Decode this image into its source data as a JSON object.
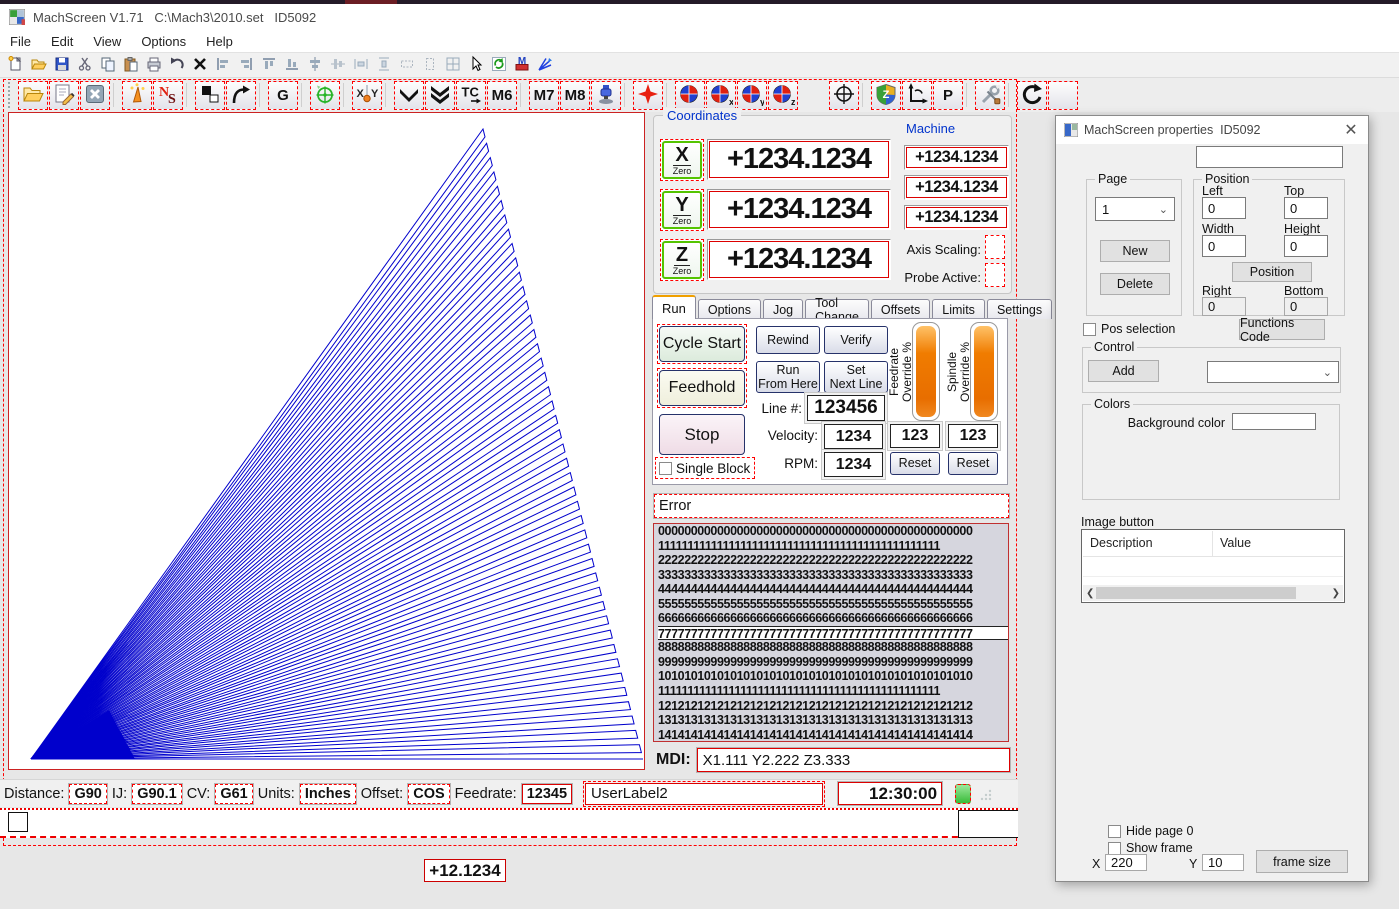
{
  "window": {
    "title": "MachScreen V1.71   C:\\Mach3\\2010.set   ID5092"
  },
  "menu": {
    "items": [
      "File",
      "Edit",
      "View",
      "Options",
      "Help"
    ]
  },
  "toolbar1": {
    "icons": [
      "new",
      "open",
      "save",
      "cut",
      "copy",
      "paste",
      "print",
      "undo",
      "delete-x",
      "align-left",
      "align-right",
      "align-top",
      "align-bottom",
      "center-v",
      "center-h",
      "space-h",
      "space-v",
      "size-a",
      "size-b",
      "grid",
      "pointer",
      "refresh-green",
      "export-m",
      "chart-fan"
    ]
  },
  "toolbar2": {
    "items": [
      {
        "icon": "folder-open"
      },
      {
        "icon": "edit-page"
      },
      {
        "icon": "close-x"
      },
      {
        "sep": true
      },
      {
        "icon": "wand"
      },
      {
        "icon": "ns-letters"
      },
      {
        "sep": true
      },
      {
        "icon": "squares"
      },
      {
        "icon": "curved-arrow"
      },
      {
        "sep": true
      },
      {
        "icon": "g-letter",
        "text": "G"
      },
      {
        "sep": true
      },
      {
        "icon": "green-target"
      },
      {
        "sep": true
      },
      {
        "icon": "xy-plumb"
      },
      {
        "sep": true
      },
      {
        "icon": "chevron-single"
      },
      {
        "icon": "chevron-double"
      },
      {
        "icon": "tc"
      },
      {
        "icon": "m-code",
        "text": "M6"
      },
      {
        "sep": true
      },
      {
        "icon": "m-code",
        "text": "M7"
      },
      {
        "icon": "m-code",
        "text": "M8"
      },
      {
        "icon": "spindle"
      },
      {
        "sep": true
      },
      {
        "icon": "red-cross"
      },
      {
        "sep": true
      },
      {
        "icon": "quad-circle"
      },
      {
        "icon": "quad-circle",
        "sub": "x"
      },
      {
        "icon": "quad-circle",
        "sub": "y"
      },
      {
        "icon": "quad-circle",
        "sub": "z"
      },
      {
        "gap": 30
      },
      {
        "icon": "crosshair"
      },
      {
        "sep": true
      },
      {
        "icon": "shield-z"
      },
      {
        "icon": "axis-return"
      },
      {
        "icon": "p-letter",
        "text": "P"
      },
      {
        "sep": true
      },
      {
        "icon": "tools"
      },
      {
        "sep": true
      },
      {
        "icon": "refresh-c"
      },
      {
        "icon": "empty"
      }
    ]
  },
  "coordinates": {
    "group_label": "Coordinates",
    "machine_label": "Machine",
    "zero_word": "Zero",
    "axes": [
      {
        "letter": "X",
        "dro": "+1234.1234",
        "machine": "+1234.1234"
      },
      {
        "letter": "Y",
        "dro": "+1234.1234",
        "machine": "+1234.1234"
      },
      {
        "letter": "Z",
        "dro": "+1234.1234",
        "machine": "+1234.1234"
      }
    ],
    "axis_scaling_label": "Axis Scaling:",
    "probe_active_label": "Probe Active:"
  },
  "tabs": {
    "labels": [
      "Run",
      "Options",
      "Jog",
      "Tool Change",
      "Offsets",
      "Limits",
      "Settings"
    ],
    "active": "Run"
  },
  "run_tab": {
    "cycle_start": "Cycle Start",
    "feedhold": "Feedhold",
    "stop": "Stop",
    "single_block": "Single Block",
    "rewind": "Rewind",
    "verify": "Verify",
    "run_from_here": "Run\nFrom Here",
    "set_next_line": "Set\nNext Line",
    "line_label": "Line #:",
    "line_value": "123456",
    "velocity_label": "Velocity:",
    "velocity_value": "1234",
    "rpm_label": "RPM:",
    "rpm_value": "1234",
    "feedrate_override_label": "Feedrate\nOverride %",
    "spindle_override_label": "Spindle\nOverride %",
    "feedrate_override_value": "123",
    "spindle_override_value": "123",
    "reset_label": "Reset"
  },
  "error_text": "Error",
  "gcode": {
    "highlight_index": 7,
    "rows": [
      "000000000000000000000000000000000000000000000000",
      "111111111111111111111111111111111111111111111111",
      "222222222222222222222222222222222222222222222222",
      "333333333333333333333333333333333333333333333333",
      "444444444444444444444444444444444444444444444444",
      "555555555555555555555555555555555555555555555555",
      "666666666666666666666666666666666666666666666666",
      "777777777777777777777777777777777777777777777777",
      "888888888888888888888888888888888888888888888888",
      "999999999999999999999999999999999999999999999999",
      "101010101010101010101010101010101010101010101010",
      "111111111111111111111111111111111111111111111111",
      "121212121212121212121212121212121212121212121212",
      "131313131313131313131313131313131313131313131313",
      "141414141414141414141414141414141414141414141414"
    ]
  },
  "mdi": {
    "label": "MDI:",
    "value": "X1.111 Y2.222 Z3.333"
  },
  "statusbar": {
    "items": [
      {
        "label": "Distance:",
        "value": "G90",
        "style": "dash"
      },
      {
        "label": "IJ:",
        "value": "G90.1",
        "style": "dash"
      },
      {
        "label": "CV:",
        "value": "G61",
        "style": "dash"
      },
      {
        "label": "Units:",
        "value": "Inches",
        "style": "dash"
      },
      {
        "label": "Offset:",
        "value": "COS",
        "style": "dash"
      },
      {
        "label": "Feedrate:",
        "value": "12345",
        "style": "solid"
      }
    ],
    "user_label": "UserLabel2",
    "time": "12:30:00"
  },
  "bottom": {
    "dro_value": "+12.1234"
  },
  "dialog": {
    "title": "MachScreen properties  ID5092",
    "close": "✕",
    "page": {
      "label": "Page",
      "selected": "1",
      "new_btn": "New",
      "delete_btn": "Delete"
    },
    "position": {
      "label": "Position",
      "left_label": "Left",
      "left": "0",
      "top_label": "Top",
      "top": "0",
      "width_label": "Width",
      "width": "0",
      "height_label": "Height",
      "height": "0",
      "button": "Position",
      "right_label": "Right",
      "right": "0",
      "bottom_label": "Bottom",
      "bottom": "0"
    },
    "pos_selection": "Pos selection",
    "functions_code": "Functions Code",
    "control": {
      "label": "Control",
      "add_btn": "Add"
    },
    "colors": {
      "label": "Colors",
      "background_label": "Background color"
    },
    "image_button": {
      "label": "Image button",
      "col1": "Description",
      "col2": "Value"
    },
    "hide_page": "Hide page 0",
    "show_frame": "Show frame",
    "x_label": "X",
    "x_value": "220",
    "y_label": "Y",
    "y_value": "10",
    "frame_size": "frame size"
  },
  "plot": {
    "stroke": "#0000cc",
    "petals": 44,
    "cap_fraction": 0.55,
    "origin": [
      22,
      646
    ],
    "apex": [
      474,
      16
    ],
    "corner": [
      634,
      646
    ],
    "solid": [
      [
        22,
        646
      ],
      [
        126,
        646
      ],
      [
        100,
        597
      ]
    ]
  }
}
